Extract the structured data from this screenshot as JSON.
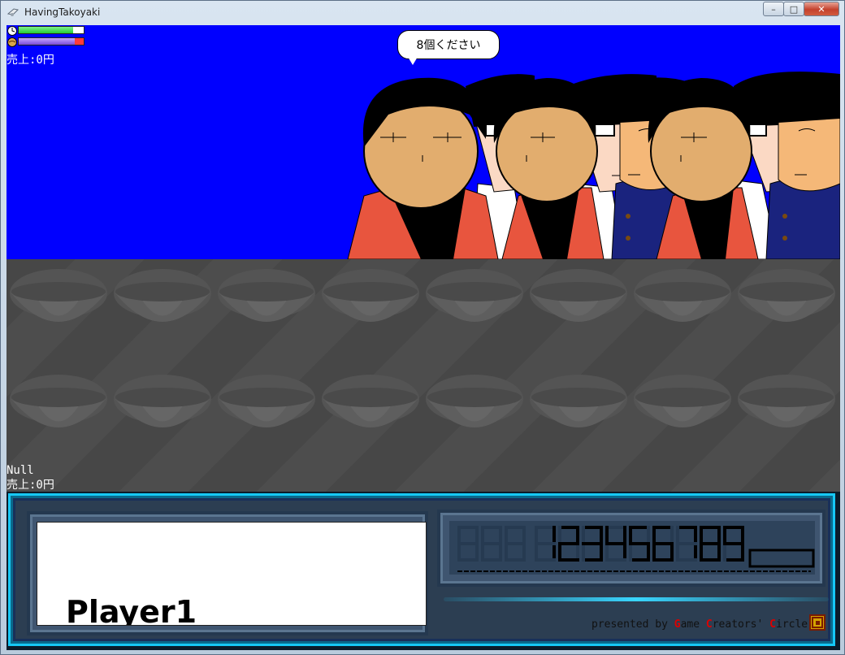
{
  "window": {
    "title": "HavingTakoyaki",
    "minimize": "–",
    "maximize": "□",
    "close": "✕"
  },
  "status": {
    "timer_level": 0.84,
    "stock_level": 0.86,
    "sales_top": "売上:0円",
    "null_label": "Null",
    "sales_bottom": "売上:0円"
  },
  "customer": {
    "speech": "8個ください"
  },
  "player": {
    "name": "Player1"
  },
  "scoreboard": {
    "digits": "123456789",
    "placeholder_digits": "888"
  },
  "credit": {
    "prefix": "presented by ",
    "g": "G",
    "g_rest": "ame ",
    "c1": "C",
    "c1_rest": "reators' ",
    "c2": "C",
    "c2_rest": "ircle.."
  },
  "colors": {
    "sky": "#0000ff",
    "hud_accent": "#16c8f5",
    "timer_bar": "#22cc33",
    "stock_bar": "#7a4bd8"
  }
}
